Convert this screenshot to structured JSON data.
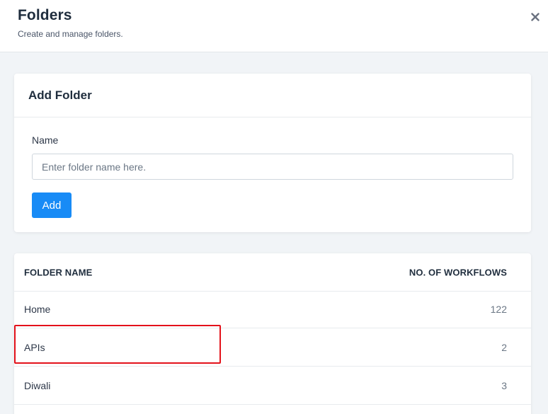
{
  "header": {
    "title": "Folders",
    "subtitle": "Create and manage folders.",
    "close_icon": "close-icon"
  },
  "add_folder": {
    "title": "Add Folder",
    "name_label": "Name",
    "name_value": "",
    "name_placeholder": "Enter folder name here.",
    "add_label": "Add",
    "accent_color": "#188bf6"
  },
  "table": {
    "columns": [
      "FOLDER NAME",
      "NO. OF WORKFLOWS"
    ],
    "rows": [
      {
        "name": "Home",
        "count": "122"
      },
      {
        "name": "APIs",
        "count": "2"
      },
      {
        "name": "Diwali",
        "count": "3"
      }
    ]
  },
  "annotation": {
    "highlight_color": "#e3121b",
    "highlighted_row": "APIs"
  }
}
